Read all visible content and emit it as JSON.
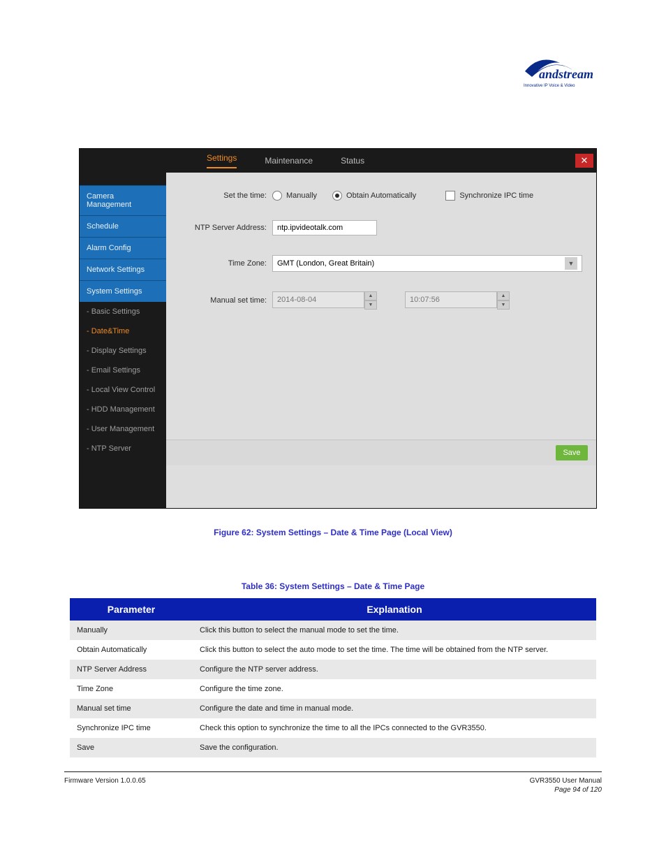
{
  "logo": {
    "brand": "Grandstream",
    "tagline": "Innovative IP Voice & Video"
  },
  "tabs": {
    "settings": "Settings",
    "maintenance": "Maintenance",
    "status": "Status"
  },
  "sidebar": {
    "main": [
      "Camera Management",
      "Schedule",
      "Alarm Config",
      "Network Settings",
      "System Settings"
    ],
    "sub": [
      "- Basic Settings",
      "- Date&Time",
      "- Display Settings",
      "- Email Settings",
      "- Local View Control",
      "- HDD Management",
      "- User Management",
      "- NTP Server"
    ],
    "active_sub_index": 1
  },
  "form": {
    "set_time_label": "Set the time:",
    "opt_manual": "Manually",
    "opt_auto": "Obtain Automatically",
    "chk_sync": "Synchronize IPC time",
    "ntp_label": "NTP Server Address:",
    "ntp_value": "ntp.ipvideotalk.com",
    "tz_label": "Time Zone:",
    "tz_value": "GMT (London, Great Britain)",
    "manual_label": "Manual set time:",
    "date_value": "2014-08-04",
    "time_value": "10:07:56",
    "save": "Save"
  },
  "captions": {
    "fig": "Figure 62: System Settings – Date & Time Page (Local View)",
    "table": "Table 36: System Settings – Date & Time Page"
  },
  "table": {
    "headers": {
      "param": "Parameter",
      "expl": "Explanation"
    },
    "rows": [
      {
        "param": "Manually",
        "expl": "Click this button to select the manual mode to set the time."
      },
      {
        "param": "Obtain Automatically",
        "expl": "Click this button to select the auto mode to set the time. The time will be obtained from the NTP server."
      },
      {
        "param": "NTP Server Address",
        "expl": "Configure the NTP server address."
      },
      {
        "param": "Time Zone",
        "expl": "Configure the time zone."
      },
      {
        "param": "Manual set time",
        "expl": "Configure the date and time in manual mode."
      },
      {
        "param": "Synchronize IPC time",
        "expl": "Check this option to synchronize the time to all the IPCs connected to the GVR3550."
      },
      {
        "param": "Save",
        "expl": "Save the configuration."
      }
    ]
  },
  "footer": {
    "left1": "Firmware Version 1.0.0.65",
    "right1": "GVR3550 User Manual",
    "left2": "",
    "right2": "Page 94 of 120"
  }
}
